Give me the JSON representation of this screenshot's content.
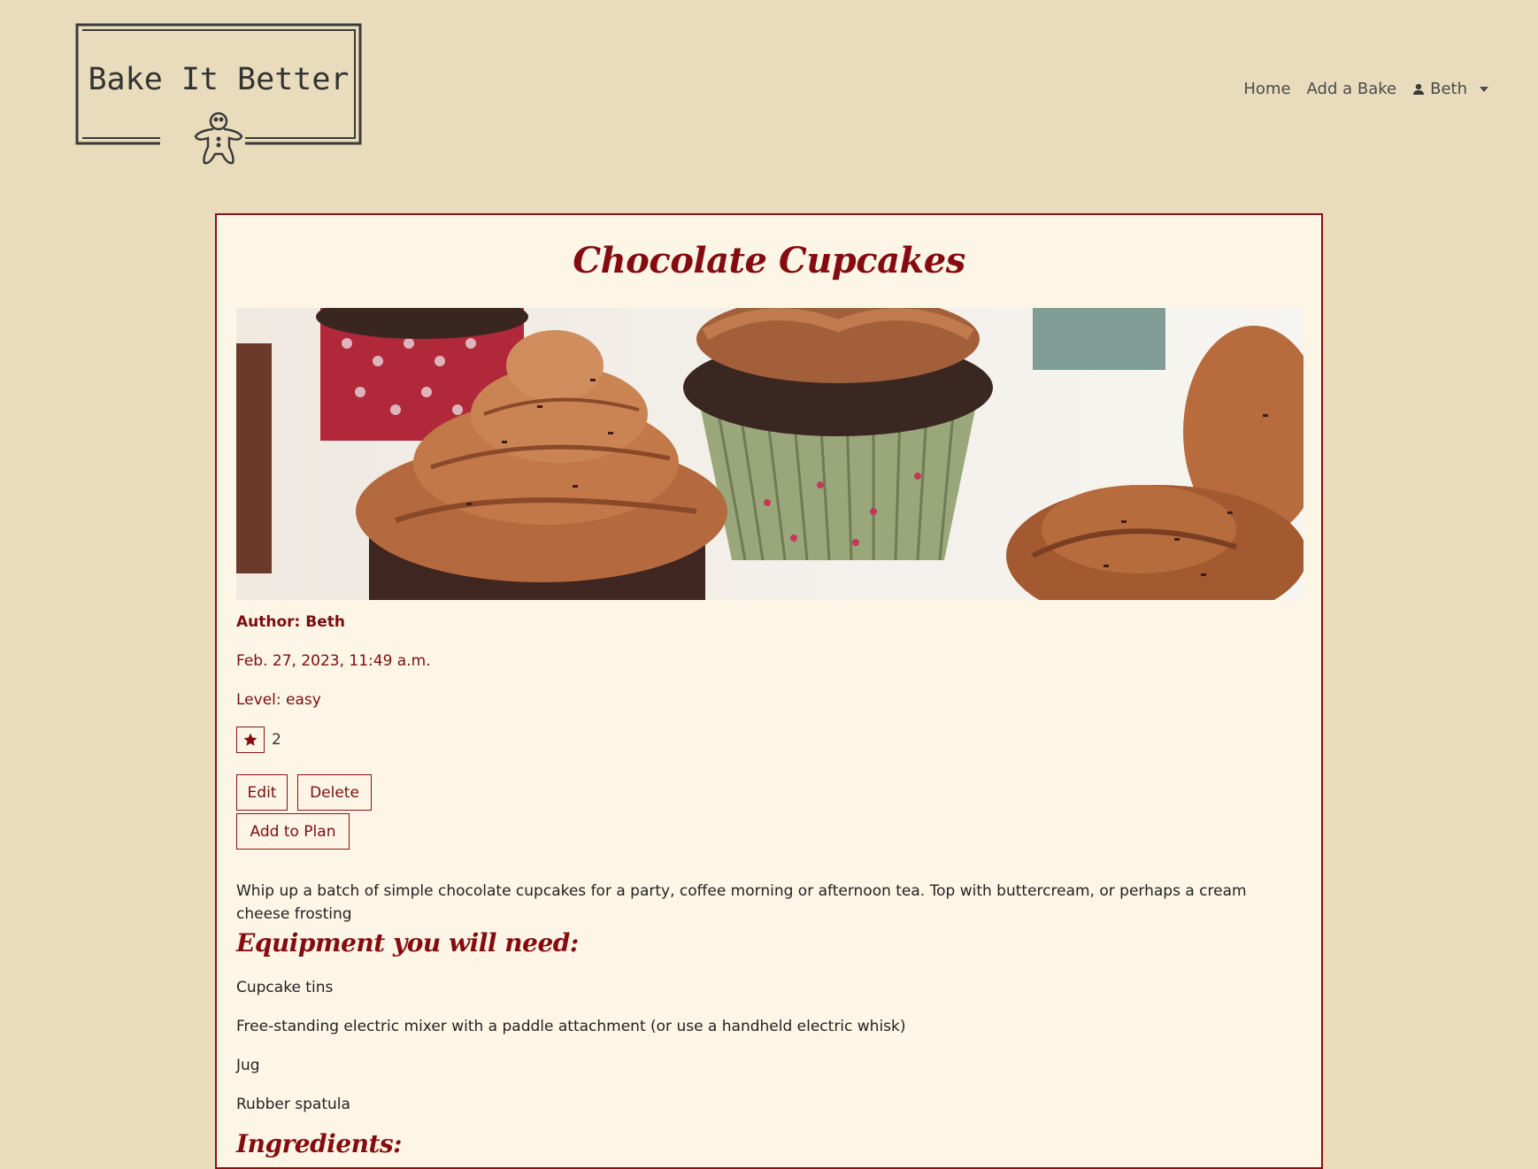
{
  "brand": {
    "name": "Bake It Better",
    "logo_icon": "gingerbread-man-icon"
  },
  "nav": {
    "home": "Home",
    "add_bake": "Add a Bake",
    "user": "Beth",
    "user_icon": "user-icon"
  },
  "recipe": {
    "title": "Chocolate Cupcakes",
    "image_alt": "chocolate cupcakes with chocolate buttercream swirls",
    "author": "Author: Beth",
    "date": "Feb. 27, 2023, 11:49 a.m.",
    "level": "Level: easy",
    "likes": "2",
    "like_icon": "star-icon",
    "description": "Whip up a batch of simple chocolate cupcakes for a party, coffee morning or afternoon tea. Top with buttercream, or perhaps a cream cheese frosting",
    "equipment_heading": "Equipment you will need:",
    "equipment": [
      "Cupcake tins",
      "Free-standing electric mixer with a paddle attachment (or use a handheld electric whisk)",
      "Jug",
      "Rubber spatula"
    ],
    "ingredients_heading": "Ingredients:"
  },
  "actions": {
    "edit": "Edit",
    "delete": "Delete",
    "add_to_plan": "Add to Plan"
  },
  "colors": {
    "background": "#e9dcbd",
    "card": "#fdf6e6",
    "accent": "#850b10"
  }
}
